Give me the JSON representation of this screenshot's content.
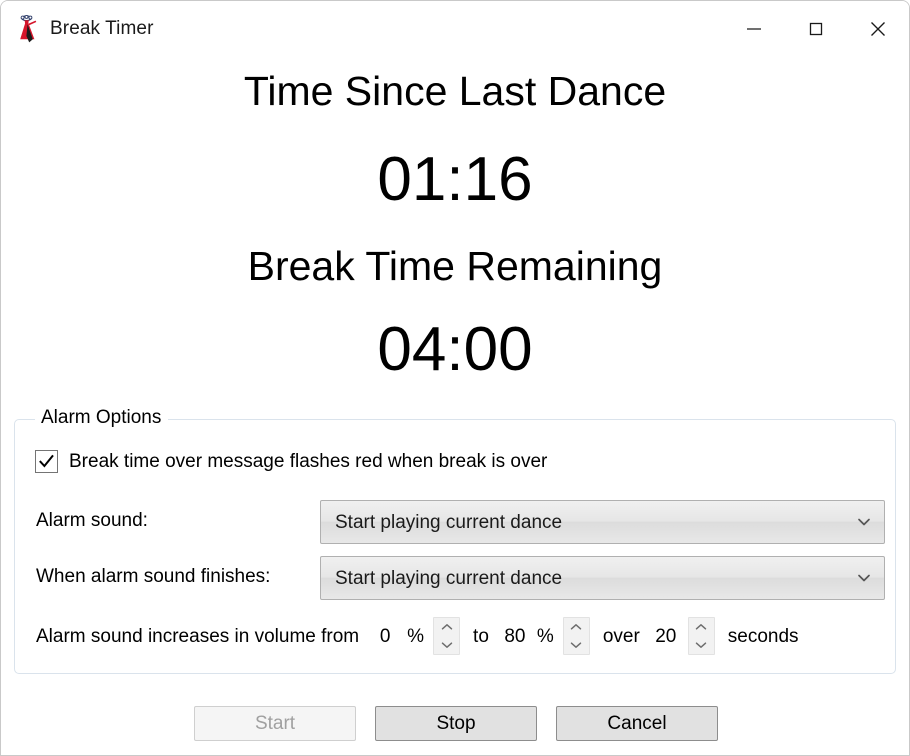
{
  "window": {
    "title": "Break Timer",
    "icon": "dancer-icon",
    "controls": {
      "minimize": "minimize-icon",
      "maximize": "maximize-icon",
      "close": "close-icon"
    }
  },
  "timers": {
    "since_last_dance_label": "Time Since Last Dance",
    "since_last_dance_value": "01:16",
    "break_remaining_label": "Break Time Remaining",
    "break_remaining_value": "04:00"
  },
  "alarm_options": {
    "legend": "Alarm Options",
    "flash_red_checkbox": {
      "label": "Break time over message flashes red when break is over",
      "checked": true
    },
    "alarm_sound": {
      "label": "Alarm sound:",
      "value": "Start playing current dance"
    },
    "when_finishes": {
      "label": "When alarm sound finishes:",
      "value": "Start playing current dance"
    },
    "volume_ramp": {
      "prefix": "Alarm sound increases in volume from",
      "from_value": "0",
      "from_unit": "%",
      "mid": "to",
      "to_value": "80",
      "to_unit": "%",
      "over": "over",
      "seconds_value": "20",
      "seconds_unit": "seconds"
    }
  },
  "buttons": {
    "start": "Start",
    "stop": "Stop",
    "cancel": "Cancel"
  },
  "colors": {
    "accent_red": "#d5152b",
    "group_border": "#dae3ec",
    "disabled_text": "#a0a0a0"
  }
}
